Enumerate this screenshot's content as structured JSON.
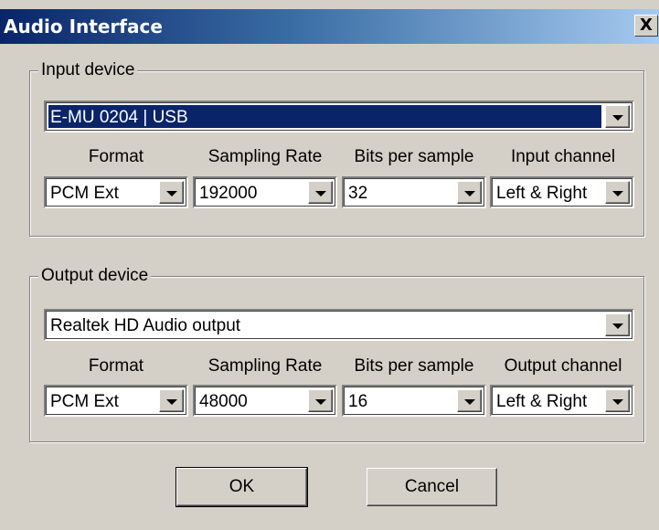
{
  "window": {
    "title": "Audio Interface",
    "close_glyph": "X"
  },
  "input": {
    "group_label": "Input device",
    "device_value": "E-MU 0204 | USB",
    "labels": {
      "format": "Format",
      "sampling_rate": "Sampling Rate",
      "bits": "Bits per sample",
      "channel": "Input channel"
    },
    "values": {
      "format": "PCM Ext",
      "sampling_rate": "192000",
      "bits": "32",
      "channel": "Left & Right"
    }
  },
  "output": {
    "group_label": "Output device",
    "device_value": "Realtek HD Audio output",
    "labels": {
      "format": "Format",
      "sampling_rate": "Sampling Rate",
      "bits": "Bits per sample",
      "channel": "Output channel"
    },
    "values": {
      "format": "PCM Ext",
      "sampling_rate": "48000",
      "bits": "16",
      "channel": "Left & Right"
    }
  },
  "buttons": {
    "ok": "OK",
    "cancel": "Cancel"
  },
  "colors": {
    "title_start": "#0a246a",
    "title_end": "#a6caf0",
    "face": "#d4d0c8",
    "selection": "#0a246a"
  },
  "icons": {
    "dropdown": "chevron-down-icon",
    "close": "close-icon"
  }
}
